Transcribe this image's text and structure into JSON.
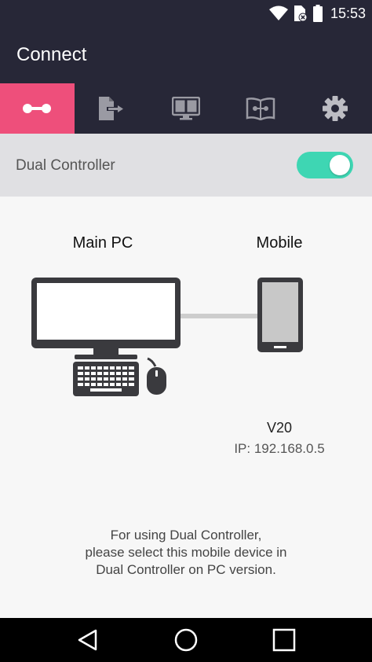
{
  "status_bar": {
    "time": "15:53",
    "icons": [
      "wifi-icon",
      "sim-no-signal-icon",
      "battery-icon"
    ]
  },
  "app_bar": {
    "title": "Connect"
  },
  "tabs": [
    {
      "name": "connect",
      "icon": "connection-icon",
      "active": true
    },
    {
      "name": "file-transfer",
      "icon": "file-transfer-icon",
      "active": false
    },
    {
      "name": "screen",
      "icon": "dual-screen-icon",
      "active": false
    },
    {
      "name": "guide",
      "icon": "book-icon",
      "active": false
    },
    {
      "name": "settings",
      "icon": "gear-icon",
      "active": false
    }
  ],
  "toggle": {
    "label": "Dual Controller",
    "enabled": true
  },
  "diagram": {
    "pc_label": "Main PC",
    "mobile_label": "Mobile"
  },
  "device": {
    "name": "V20",
    "ip": "IP: 192.168.0.5"
  },
  "instructions": {
    "line1": "For using Dual Controller,",
    "line2": "please select this mobile device in",
    "line3": "Dual Controller on PC version."
  },
  "colors": {
    "header_bg": "#272737",
    "active_tab": "#ee4f7b",
    "toggle_on": "#3ed6b3",
    "toggle_row_bg": "#e0e0e3"
  }
}
